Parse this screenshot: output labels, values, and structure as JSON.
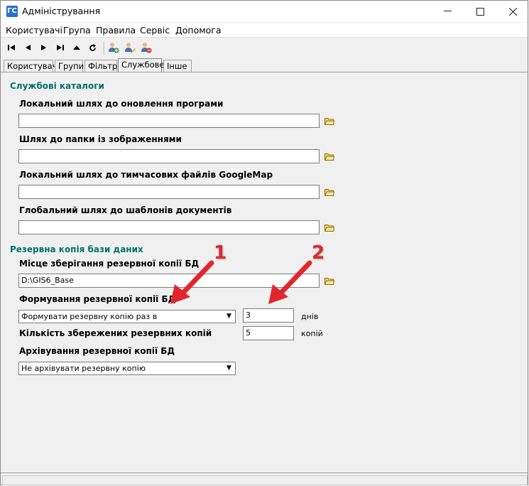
{
  "window": {
    "title": "Адміністрування",
    "icon_glyph": "ГС"
  },
  "menu": [
    "Користувачі",
    "Група",
    "Правила",
    "Сервіс",
    "Допомога"
  ],
  "tabs": [
    "Користувачі",
    "Групи",
    "Фільтр",
    "Службове",
    "Інше"
  ],
  "active_tab": "Службове",
  "sections": {
    "catalogs": {
      "title": "Службові каталоги",
      "fields": [
        {
          "label": "Локальний шлях до оновлення програми",
          "value": ""
        },
        {
          "label": "Шлях до папки із зображеннями",
          "value": ""
        },
        {
          "label": "Локальний шлях до тимчасових файлів GoogleMap",
          "value": ""
        },
        {
          "label": "Глобальний шлях до шаблонів документів",
          "value": ""
        }
      ]
    },
    "backup": {
      "title": "Резервна копія бази даних",
      "location_label": "Місце зберігання резервної копії БД",
      "location_value": "D:\\GIS6_Base",
      "formation_label": "Формування резервної копії БД",
      "formation_value": "Формувати резервну копію раз в",
      "days_value": "3",
      "days_unit": "днів",
      "count_label": "Кількість збережених резервних копій",
      "count_value": "5",
      "count_unit": "копій",
      "archive_label": "Архівування резервної копії БД",
      "archive_value": "Не архівувати резервну копію"
    }
  },
  "annotations": [
    "1",
    "2"
  ],
  "colors": {
    "section_title": "#007070",
    "arrow": "#e1262d"
  }
}
